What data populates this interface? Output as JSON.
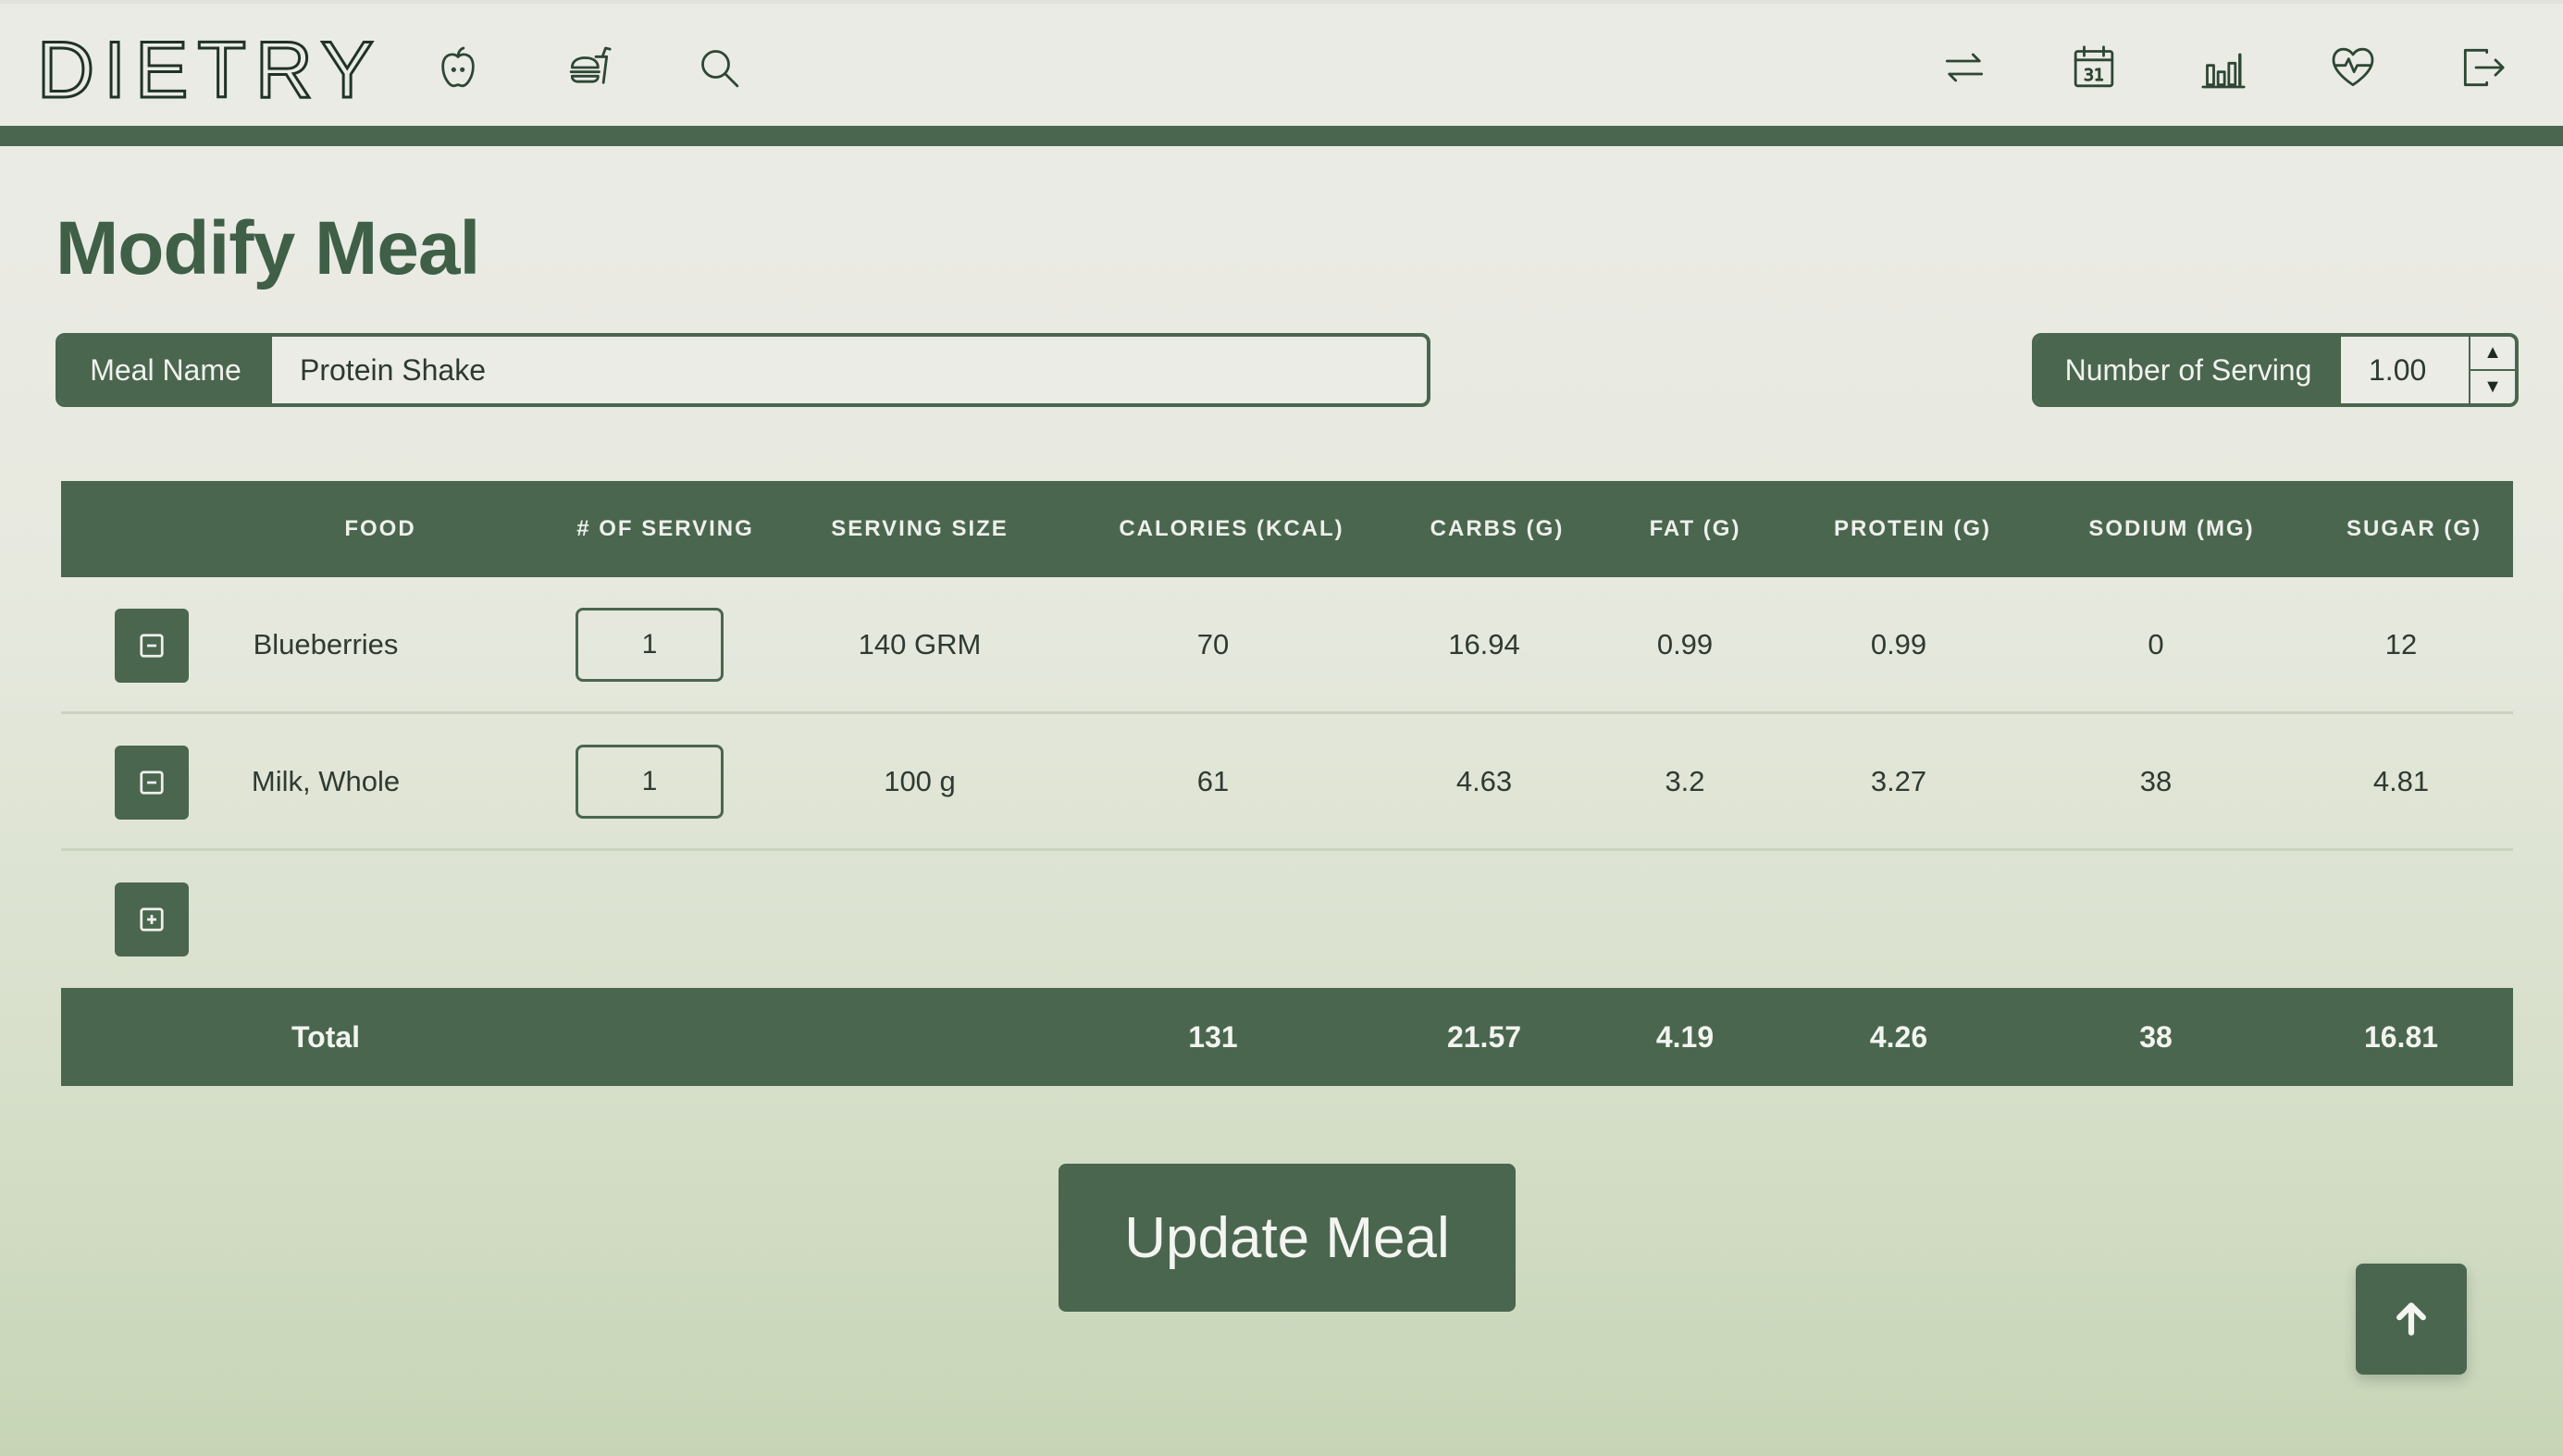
{
  "app": {
    "logo": "DIETRY"
  },
  "nav": {
    "left_icons": [
      "apple-icon",
      "food-icon",
      "search-icon"
    ],
    "right_icons": [
      "swap-icon",
      "calendar-icon",
      "chart-icon",
      "heart-rate-icon",
      "logout-icon"
    ],
    "calendar_day": "31"
  },
  "page": {
    "title": "Modify Meal"
  },
  "meal_name": {
    "label": "Meal Name",
    "value": "Protein Shake"
  },
  "servings": {
    "label": "Number of Serving",
    "value": "1.00"
  },
  "table": {
    "headers": [
      "FOOD",
      "# OF SERVING",
      "SERVING SIZE",
      "CALORIES (KCAL)",
      "CARBS (G)",
      "FAT (G)",
      "PROTEIN (G)",
      "SODIUM (MG)",
      "SUGAR (G)"
    ],
    "rows": [
      {
        "food": "Blueberries",
        "servings": "1",
        "size": "140 GRM",
        "calories": "70",
        "carbs": "16.94",
        "fat": "0.99",
        "protein": "0.99",
        "sodium": "0",
        "sugar": "12"
      },
      {
        "food": "Milk, Whole",
        "servings": "1",
        "size": "100 g",
        "calories": "61",
        "carbs": "4.63",
        "fat": "3.2",
        "protein": "3.27",
        "sodium": "38",
        "sugar": "4.81"
      }
    ],
    "total": {
      "label": "Total",
      "calories": "131",
      "carbs": "21.57",
      "fat": "4.19",
      "protein": "4.26",
      "sodium": "38",
      "sugar": "16.81"
    }
  },
  "actions": {
    "update_label": "Update Meal"
  },
  "colors": {
    "accent": "#4a664f",
    "background_top": "#ececE7",
    "background_bottom": "#c7d5b6"
  }
}
